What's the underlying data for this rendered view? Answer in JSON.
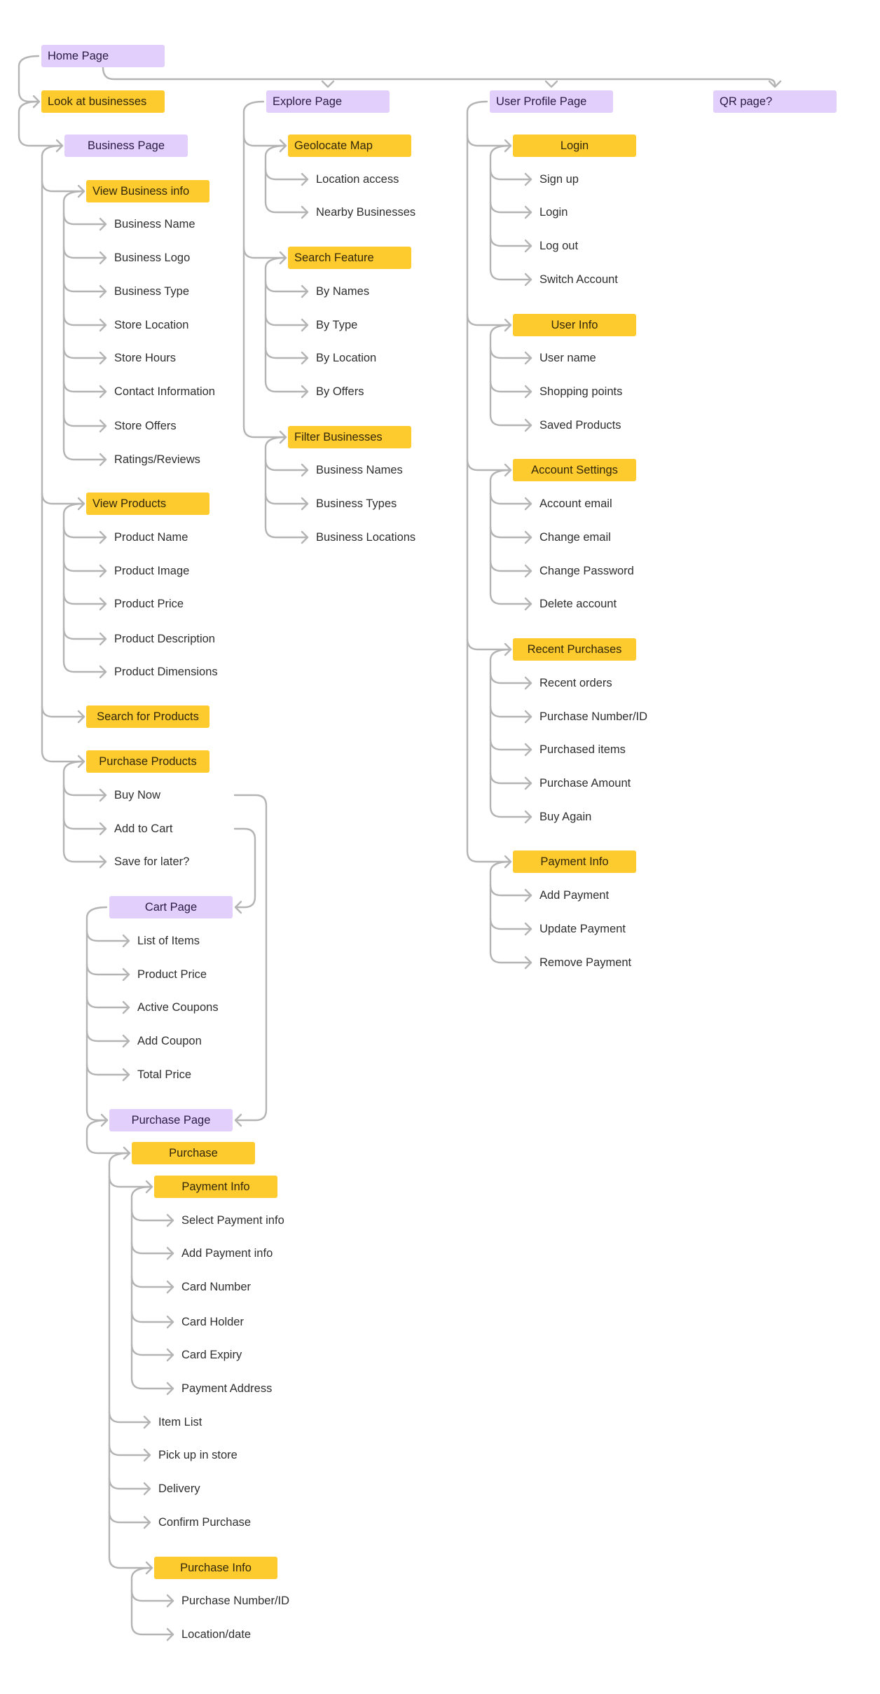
{
  "diagram": {
    "title": "App sitemap / user flow",
    "colors": {
      "page_fill": "#E2CFFC",
      "feature_fill": "#FDCB2E",
      "connector": "#B4B4B4",
      "text": "#2F2F2F"
    },
    "columns": [
      {
        "name": "home",
        "roots": [
          {
            "label": "Home Page",
            "type": "page",
            "children": [
              {
                "label": "Look at businesses",
                "type": "feature",
                "children": [
                  {
                    "label": "Business Page",
                    "type": "page",
                    "children": [
                      {
                        "label": "View Business info",
                        "type": "feature",
                        "children": [
                          {
                            "label": "Business Name",
                            "type": "item"
                          },
                          {
                            "label": "Business Logo",
                            "type": "item"
                          },
                          {
                            "label": "Business Type",
                            "type": "item"
                          },
                          {
                            "label": "Store Location",
                            "type": "item"
                          },
                          {
                            "label": "Store Hours",
                            "type": "item"
                          },
                          {
                            "label": "Contact Information",
                            "type": "item"
                          },
                          {
                            "label": "Store Offers",
                            "type": "item"
                          },
                          {
                            "label": "Ratings/Reviews",
                            "type": "item"
                          }
                        ]
                      },
                      {
                        "label": "View Products",
                        "type": "feature",
                        "children": [
                          {
                            "label": "Product Name",
                            "type": "item"
                          },
                          {
                            "label": "Product Image",
                            "type": "item"
                          },
                          {
                            "label": "Product Price",
                            "type": "item"
                          },
                          {
                            "label": "Product Description",
                            "type": "item"
                          },
                          {
                            "label": "Product Dimensions",
                            "type": "item"
                          }
                        ]
                      },
                      {
                        "label": "Search for Products",
                        "type": "feature",
                        "children": []
                      },
                      {
                        "label": "Purchase Products",
                        "type": "feature",
                        "children": [
                          {
                            "label": "Buy Now",
                            "type": "item"
                          },
                          {
                            "label": "Add to Cart",
                            "type": "item"
                          },
                          {
                            "label": "Save for later?",
                            "type": "item"
                          }
                        ]
                      }
                    ]
                  }
                ]
              }
            ]
          },
          {
            "label": "Cart Page",
            "type": "page",
            "children": [
              {
                "label": "List of Items",
                "type": "item"
              },
              {
                "label": "Product Price",
                "type": "item"
              },
              {
                "label": "Active Coupons",
                "type": "item"
              },
              {
                "label": "Add Coupon",
                "type": "item"
              },
              {
                "label": "Total Price",
                "type": "item"
              },
              {
                "label": "Purchase Page",
                "type": "page",
                "children": [
                  {
                    "label": "Purchase",
                    "type": "feature",
                    "children": [
                      {
                        "label": "Payment Info",
                        "type": "feature",
                        "children": [
                          {
                            "label": "Select Payment info",
                            "type": "item"
                          },
                          {
                            "label": "Add Payment info",
                            "type": "item"
                          },
                          {
                            "label": "Card Number",
                            "type": "item"
                          },
                          {
                            "label": "Card Holder",
                            "type": "item"
                          },
                          {
                            "label": "Card Expiry",
                            "type": "item"
                          },
                          {
                            "label": "Payment Address",
                            "type": "item"
                          }
                        ]
                      },
                      {
                        "label": "Item List",
                        "type": "item"
                      },
                      {
                        "label": "Pick up in store",
                        "type": "item"
                      },
                      {
                        "label": "Delivery",
                        "type": "item"
                      },
                      {
                        "label": "Confirm Purchase",
                        "type": "item"
                      },
                      {
                        "label": "Purchase Info",
                        "type": "feature",
                        "children": [
                          {
                            "label": "Purchase Number/ID",
                            "type": "item"
                          },
                          {
                            "label": "Location/date",
                            "type": "item"
                          }
                        ]
                      }
                    ]
                  }
                ]
              }
            ]
          }
        ]
      },
      {
        "name": "explore",
        "roots": [
          {
            "label": "Explore Page",
            "type": "page",
            "children": [
              {
                "label": "Geolocate Map",
                "type": "feature",
                "children": [
                  {
                    "label": "Location access",
                    "type": "item"
                  },
                  {
                    "label": "Nearby Businesses",
                    "type": "item"
                  }
                ]
              },
              {
                "label": "Search Feature",
                "type": "feature",
                "children": [
                  {
                    "label": "By Names",
                    "type": "item"
                  },
                  {
                    "label": "By Type",
                    "type": "item"
                  },
                  {
                    "label": "By Location",
                    "type": "item"
                  },
                  {
                    "label": "By Offers",
                    "type": "item"
                  }
                ]
              },
              {
                "label": "Filter Businesses",
                "type": "feature",
                "children": [
                  {
                    "label": "Business Names",
                    "type": "item"
                  },
                  {
                    "label": "Business Types",
                    "type": "item"
                  },
                  {
                    "label": "Business Locations",
                    "type": "item"
                  }
                ]
              }
            ]
          }
        ]
      },
      {
        "name": "user-profile",
        "roots": [
          {
            "label": "User Profile Page",
            "type": "page",
            "children": [
              {
                "label": "Login",
                "type": "feature",
                "children": [
                  {
                    "label": "Sign up",
                    "type": "item"
                  },
                  {
                    "label": "Login",
                    "type": "item"
                  },
                  {
                    "label": "Log out",
                    "type": "item"
                  },
                  {
                    "label": "Switch Account",
                    "type": "item"
                  }
                ]
              },
              {
                "label": "User Info",
                "type": "feature",
                "children": [
                  {
                    "label": "User name",
                    "type": "item"
                  },
                  {
                    "label": "Shopping points",
                    "type": "item"
                  },
                  {
                    "label": "Saved Products",
                    "type": "item"
                  }
                ]
              },
              {
                "label": "Account Settings",
                "type": "feature",
                "children": [
                  {
                    "label": "Account email",
                    "type": "item"
                  },
                  {
                    "label": "Change email",
                    "type": "item"
                  },
                  {
                    "label": "Change Password",
                    "type": "item"
                  },
                  {
                    "label": "Delete account",
                    "type": "item"
                  }
                ]
              },
              {
                "label": "Recent Purchases",
                "type": "feature",
                "children": [
                  {
                    "label": "Recent orders",
                    "type": "item"
                  },
                  {
                    "label": "Purchase Number/ID",
                    "type": "item"
                  },
                  {
                    "label": "Purchased items",
                    "type": "item"
                  },
                  {
                    "label": "Purchase Amount",
                    "type": "item"
                  },
                  {
                    "label": "Buy Again",
                    "type": "item"
                  }
                ]
              },
              {
                "label": "Payment Info",
                "type": "feature",
                "children": [
                  {
                    "label": "Add Payment",
                    "type": "item"
                  },
                  {
                    "label": "Update Payment",
                    "type": "item"
                  },
                  {
                    "label": "Remove Payment",
                    "type": "item"
                  }
                ]
              }
            ]
          }
        ]
      },
      {
        "name": "qr",
        "roots": [
          {
            "label": "QR page?",
            "type": "page",
            "children": []
          }
        ]
      }
    ],
    "cross_links": [
      {
        "from": "Home Page",
        "to": [
          "Explore Page",
          "User Profile Page",
          "QR page?"
        ]
      },
      {
        "from": "Buy Now",
        "to": [
          "Purchase Page"
        ]
      },
      {
        "from": "Add to Cart",
        "to": [
          "Cart Page"
        ]
      }
    ]
  }
}
